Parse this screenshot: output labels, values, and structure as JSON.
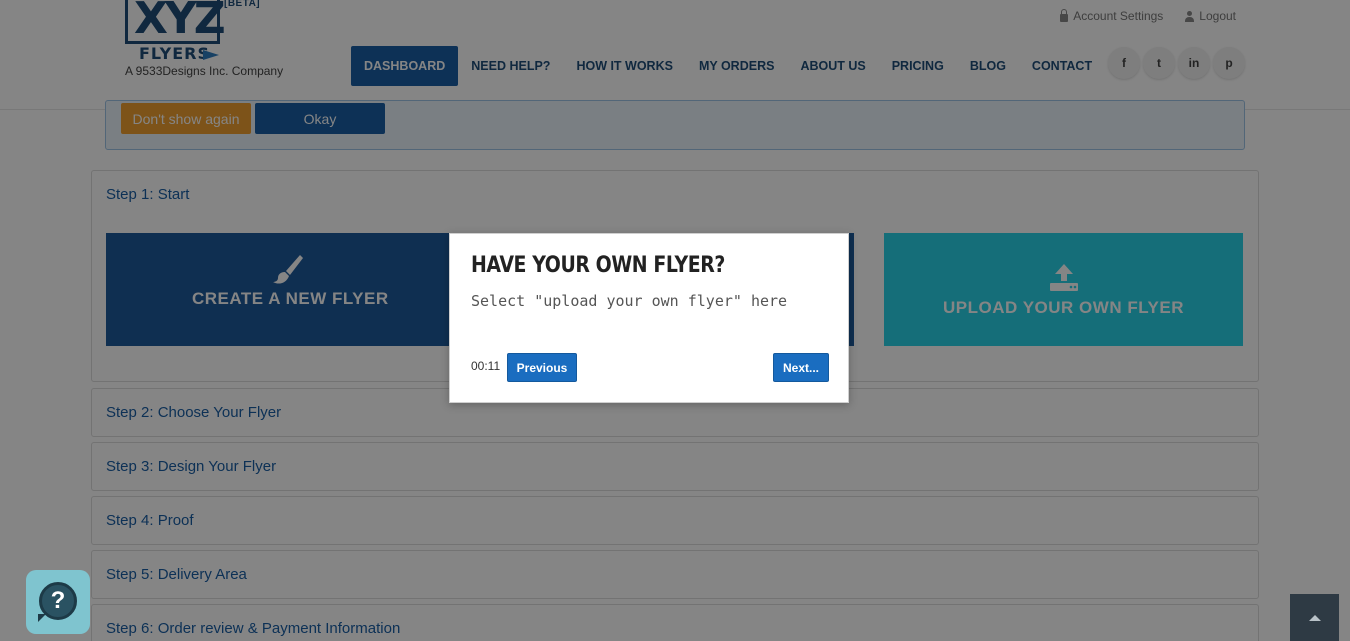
{
  "header": {
    "logo": {
      "beta": "[BETA]",
      "xyz": "XYZ",
      "flyers": "FLYERS",
      "tagline": "A 9533Designs Inc. Company"
    },
    "account_settings": "Account Settings",
    "logout": "Logout",
    "nav": [
      {
        "label": "DASHBOARD",
        "active": true
      },
      {
        "label": "NEED HELP?"
      },
      {
        "label": "HOW IT WORKS"
      },
      {
        "label": "MY ORDERS"
      },
      {
        "label": "ABOUT US"
      },
      {
        "label": "PRICING"
      },
      {
        "label": "BLOG"
      },
      {
        "label": "CONTACT"
      }
    ],
    "socials": [
      {
        "icon": "facebook-icon",
        "glyph": "f"
      },
      {
        "icon": "twitter-icon",
        "glyph": "t"
      },
      {
        "icon": "linkedin-icon",
        "glyph": "in"
      },
      {
        "icon": "pinterest-icon",
        "glyph": "p"
      }
    ]
  },
  "notice": {
    "dont_show": "Don't show again",
    "okay": "Okay"
  },
  "steps": {
    "step1": "Step 1: Start",
    "rows": [
      "Step 2: Choose Your Flyer",
      "Step 3: Design Your Flyer",
      "Step 4: Proof",
      "Step 5: Delivery Area",
      "Step 6: Order review & Payment Information"
    ]
  },
  "cards": {
    "create": "CREATE A NEW FLYER",
    "upload": "UPLOAD YOUR OWN FLYER"
  },
  "tour": {
    "title": "HAVE YOUR OWN FLYER?",
    "subtitle": "Select \"upload your own flyer\" here",
    "timer": "00:11",
    "previous": "Previous",
    "next": "Next..."
  },
  "colors": {
    "brand": "#1f4e79",
    "primary": "#1a5fa5",
    "upload": "#29d4e8",
    "warning": "#f0a030"
  },
  "help": {
    "glyph": "?"
  }
}
